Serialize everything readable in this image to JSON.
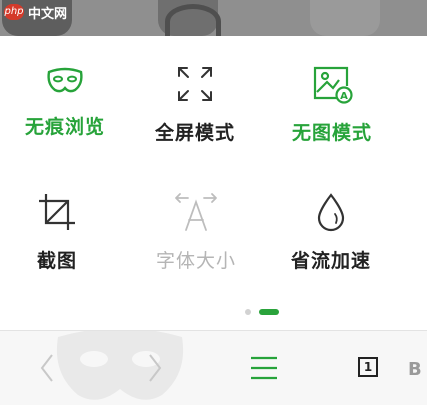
{
  "watermark": {
    "logo_text": "php",
    "text": "中文网"
  },
  "menu": {
    "row1": [
      {
        "label": "无痕浏览",
        "icon": "incognito-mask-icon",
        "state": "active"
      },
      {
        "label": "全屏模式",
        "icon": "fullscreen-arrows-icon",
        "state": "normal"
      },
      {
        "label": "无图模式",
        "icon": "no-image-mode-icon",
        "state": "active"
      }
    ],
    "row2": [
      {
        "label": "截图",
        "icon": "crop-screenshot-icon",
        "state": "normal"
      },
      {
        "label": "字体大小",
        "icon": "font-size-icon",
        "state": "disabled"
      },
      {
        "label": "省流加速",
        "icon": "water-drop-icon",
        "state": "normal"
      }
    ],
    "page_indicator": {
      "pages": 2,
      "current": 2
    }
  },
  "toolbar": {
    "back": "chevron-left-icon",
    "forward": "chevron-right-icon",
    "menu": "hamburger-menu-icon",
    "tab_count": "1",
    "watermark_fragment": "B"
  },
  "colors": {
    "accent": "#27a33a",
    "disabled": "#b5b5b5",
    "text": "#222222"
  }
}
